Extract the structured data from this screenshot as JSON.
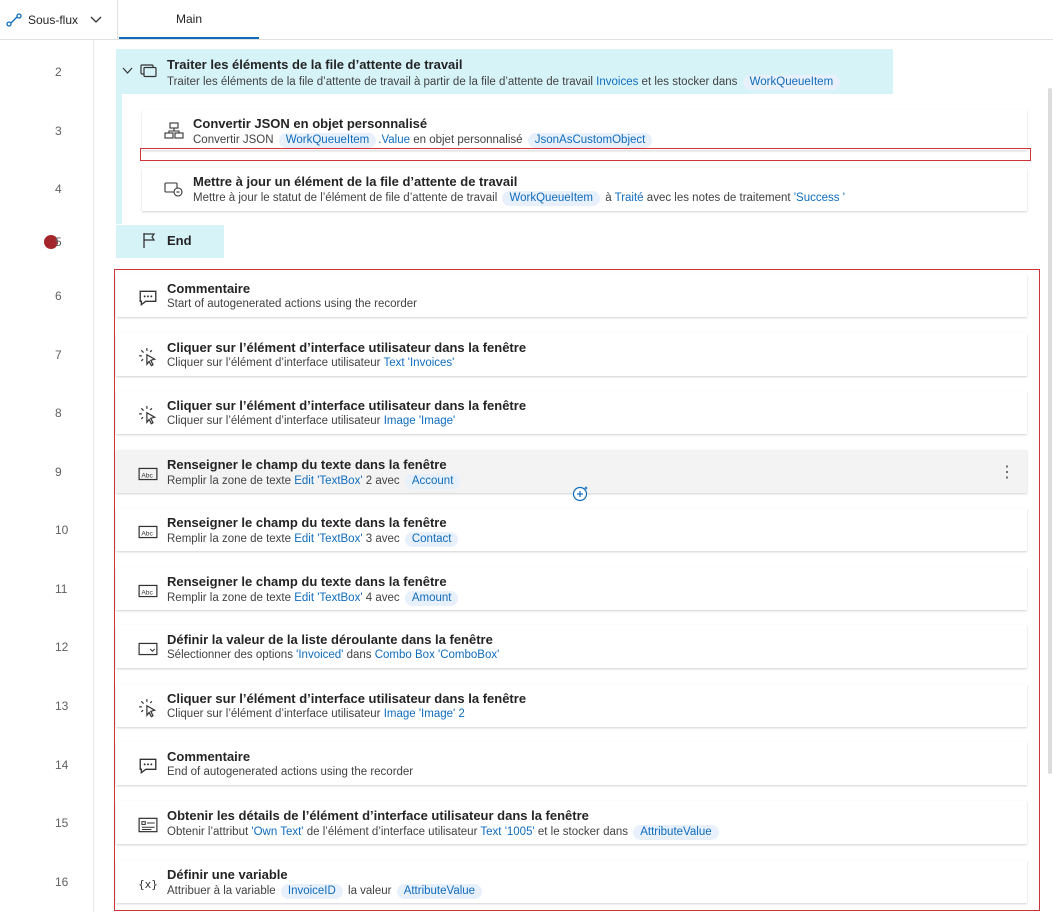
{
  "header": {
    "subflows_label": "Sous-flux",
    "main_tab": "Main"
  },
  "lines": [
    "2",
    "3",
    "4",
    "5",
    "6",
    "7",
    "8",
    "9",
    "10",
    "11",
    "12",
    "13",
    "14",
    "15",
    "16"
  ],
  "loop": {
    "title": "Traiter les éléments de la file d’attente de travail",
    "desc_prefix": "Traiter les éléments de la file d’attente de travail à partir de la file d’attente de travail",
    "queue": "Invoices",
    "desc_mid": "et les stocker dans",
    "var": "WorkQueueItem"
  },
  "a3": {
    "title": "Convertir JSON en objet personnalisé",
    "p1": "Convertir JSON",
    "var1": "WorkQueueItem",
    "prop": ".Value",
    "p2": "en objet personnalisé",
    "var2": "JsonAsCustomObject"
  },
  "a4": {
    "title": "Mettre à jour un élément de la file d’attente de travail",
    "p1": "Mettre à jour le statut de l’élément de file d’attente de travail",
    "var1": "WorkQueueItem",
    "p2": "à",
    "status": "Traité",
    "p3": "avec les notes de traitement",
    "notes": "'Success '"
  },
  "end": {
    "title": "End"
  },
  "a6": {
    "title": "Commentaire",
    "text": "Start of autogenerated actions using the recorder"
  },
  "a7": {
    "title": "Cliquer sur l’élément d’interface utilisateur dans la fenêtre",
    "p1": "Cliquer sur l’élément d’interface utilisateur",
    "el": "Text 'Invoices'"
  },
  "a8": {
    "title": "Cliquer sur l’élément d’interface utilisateur dans la fenêtre",
    "p1": "Cliquer sur l’élément d’interface utilisateur",
    "el": "Image 'Image'"
  },
  "a9": {
    "title": "Renseigner le champ du texte dans la fenêtre",
    "p1": "Remplir la zone de texte",
    "el": "Edit 'TextBox'",
    "n": "2",
    "p2": "avec",
    "var": "Account"
  },
  "a10": {
    "title": "Renseigner le champ du texte dans la fenêtre",
    "p1": "Remplir la zone de texte",
    "el": "Edit 'TextBox'",
    "n": "3",
    "p2": "avec",
    "var": "Contact"
  },
  "a11": {
    "title": "Renseigner le champ du texte dans la fenêtre",
    "p1": "Remplir la zone de texte",
    "el": "Edit 'TextBox'",
    "n": "4",
    "p2": "avec",
    "var": "Amount"
  },
  "a12": {
    "title": "Définir la valeur de la liste déroulante dans la fenêtre",
    "p1": "Sélectionner des options",
    "opt": "'Invoiced'",
    "p2": "dans",
    "el": "Combo Box 'ComboBox'"
  },
  "a13": {
    "title": "Cliquer sur l’élément d’interface utilisateur dans la fenêtre",
    "p1": "Cliquer sur l’élément d’interface utilisateur",
    "el": "Image 'Image'",
    "n": "2"
  },
  "a14": {
    "title": "Commentaire",
    "text": "End of autogenerated actions using the recorder"
  },
  "a15": {
    "title": "Obtenir les détails de l’élément d’interface utilisateur dans la fenêtre",
    "p1": "Obtenir l’attribut",
    "attr": "'Own Text'",
    "p2": "de l’élément d’interface utilisateur",
    "el": "Text '1005'",
    "p3": "et le stocker dans",
    "var": "AttributeValue"
  },
  "a16": {
    "title": "Définir une variable",
    "p1": "Attribuer à la variable",
    "var": "InvoiceID",
    "p2": "la valeur",
    "val": "AttributeValue"
  },
  "icons": {
    "x_icon_text": "{x}"
  },
  "colors": {
    "accent": "#0f6cbd",
    "loop_bg": "#d6f3f8",
    "breakpoint": "#a4262c",
    "selection": "#d13438"
  }
}
